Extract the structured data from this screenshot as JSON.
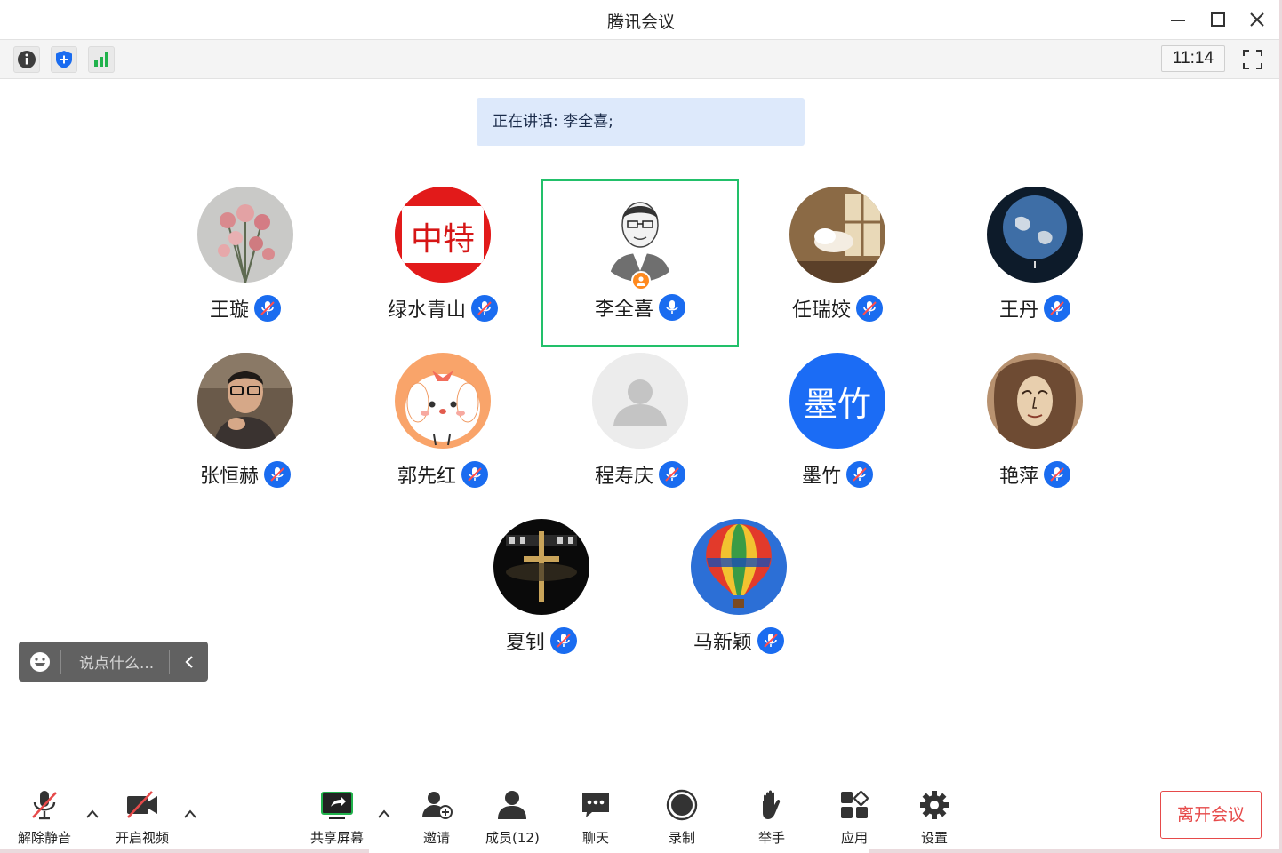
{
  "window": {
    "title": "腾讯会议"
  },
  "infobar": {
    "time": "11:14"
  },
  "speaking": {
    "text": "正在讲话: 李全喜;"
  },
  "participants": [
    {
      "name": "王璇",
      "muted": true
    },
    {
      "name": "绿水青山",
      "muted": true,
      "avatar_text": "中特"
    },
    {
      "name": "李全喜",
      "muted": false,
      "host": true,
      "speaking": true
    },
    {
      "name": "任瑞姣",
      "muted": true
    },
    {
      "name": "王丹",
      "muted": true
    },
    {
      "name": "张恒赫",
      "muted": true
    },
    {
      "name": "郭先红",
      "muted": true
    },
    {
      "name": "程寿庆",
      "muted": true
    },
    {
      "name": "墨竹",
      "muted": true,
      "avatar_text": "墨竹"
    },
    {
      "name": "艳萍",
      "muted": true
    },
    {
      "name": "夏钊",
      "muted": true
    },
    {
      "name": "马新颖",
      "muted": true
    }
  ],
  "chat": {
    "placeholder": "说点什么..."
  },
  "toolbar": {
    "unmute": "解除静音",
    "start_video": "开启视频",
    "share_screen": "共享屏幕",
    "invite": "邀请",
    "members": "成员(12)",
    "chat": "聊天",
    "record": "录制",
    "raise_hand": "举手",
    "apps": "应用",
    "settings": "设置",
    "leave": "离开会议"
  },
  "colors": {
    "accent": "#1a6cf0",
    "active_border": "#22c06a",
    "leave": "#e64a4a",
    "speaking_bg": "#dde9fb"
  }
}
